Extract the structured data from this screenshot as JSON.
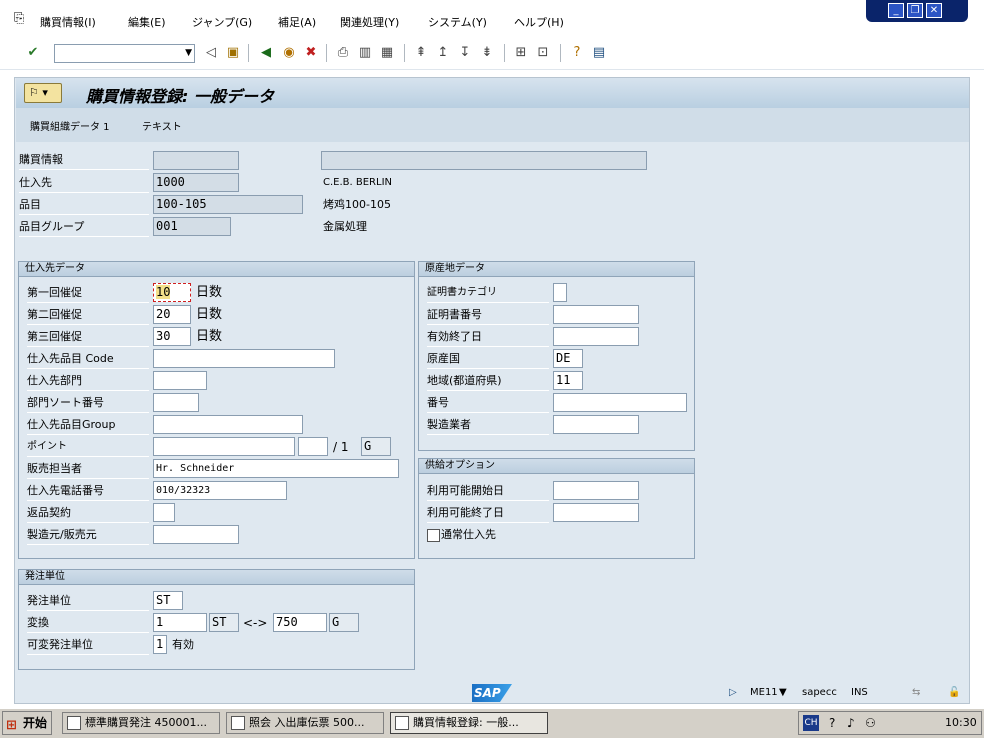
{
  "menu": [
    "購買情報(I)",
    "編集(E)",
    "ジャンプ(G)",
    "補足(A)",
    "関連処理(Y)",
    "システム(Y)",
    "ヘルプ(H)"
  ],
  "title": "購買情報登録: 一般データ",
  "subtabs": [
    "購買組織データ 1",
    "テキスト"
  ],
  "header": {
    "info_label": "購買情報",
    "vendor_label": "仕入先",
    "vendor_value": "1000",
    "vendor_name": "C.E.B. BERLIN",
    "material_label": "品目",
    "material_value": "100-105",
    "material_name": "烤鸡100-105",
    "matgroup_label": "品目グループ",
    "matgroup_value": "001",
    "matgroup_name": "金属処理"
  },
  "vendor_data": {
    "title": "仕入先データ",
    "r1_label": "第一回催促",
    "r1_value": "10",
    "r1_unit": "日数",
    "r2_label": "第二回催促",
    "r2_value": "20",
    "r2_unit": "日数",
    "r3_label": "第三回催促",
    "r3_value": "30",
    "r3_unit": "日数",
    "vmat_label": "仕入先品目 Code",
    "vsub_label": "仕入先部門",
    "vsort_label": "部門ソート番号",
    "vgroup_label": "仕入先品目Group",
    "points_label": "ポイント",
    "points_per": "/ 1",
    "points_unit": "G",
    "sales_label": "販売担当者",
    "sales_value": "Hr. Schneider",
    "phone_label": "仕入先電話番号",
    "phone_value": "010/32323",
    "return_label": "返品契約",
    "mfr_label": "製造元/販売元"
  },
  "origin_data": {
    "title": "原産地データ",
    "cert_cat_label": "証明書カテゴリ",
    "cert_no_label": "証明書番号",
    "valid_to_label": "有効終了日",
    "country_label": "原産国",
    "country_value": "DE",
    "region_label": "地域(都道府県)",
    "region_value": "11",
    "number_label": "番号",
    "manufacturer_label": "製造業者"
  },
  "supply": {
    "title": "供給オプション",
    "from_label": "利用可能開始日",
    "to_label": "利用可能終了日",
    "regular_label": "通常仕入先"
  },
  "order_unit": {
    "title": "発注単位",
    "unit_label": "発注単位",
    "unit_value": "ST",
    "conv_label": "変換",
    "conv_num": "1",
    "conv_unit1": "ST",
    "conv_arrow": "<->",
    "conv_den": "750",
    "conv_unit2": "G",
    "var_label": "可変発注単位",
    "var_value": "1",
    "var_text": "有効"
  },
  "status": {
    "logo": "SAP",
    "tx": "ME11",
    "system": "sapecc",
    "mode": "INS"
  },
  "taskbar": {
    "start": "开始",
    "tasks": [
      "標準購買発注 450001...",
      "照会 入出庫伝票 500...",
      "購買情報登録: 一般..."
    ],
    "time": "10:30"
  }
}
